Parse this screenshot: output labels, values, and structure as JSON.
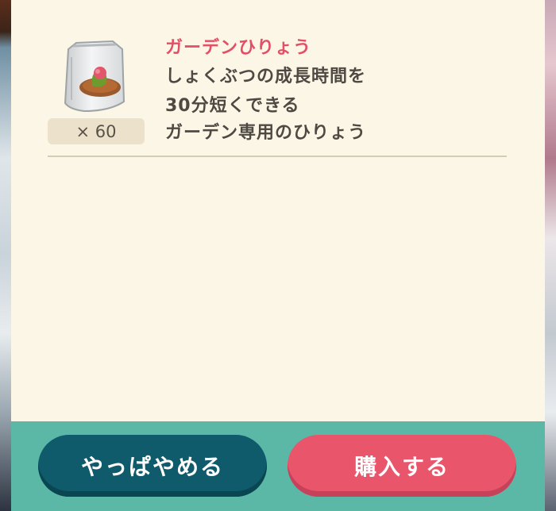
{
  "item": {
    "icon": "fertilizer-bag-icon",
    "quantity": "× 60",
    "name": "ガーデンひりょう",
    "description_lines": [
      "しょくぶつの成長時間を",
      "30分短くできる",
      "ガーデン専用のひりょう"
    ]
  },
  "buttons": {
    "cancel_label": "やっぱやめる",
    "buy_label": "購入する"
  },
  "colors": {
    "panel": "#fbf6e6",
    "footer": "#5bb8a6",
    "title": "#e24f66",
    "cancel_button": "#0f5b6b",
    "buy_button": "#e9566c"
  }
}
